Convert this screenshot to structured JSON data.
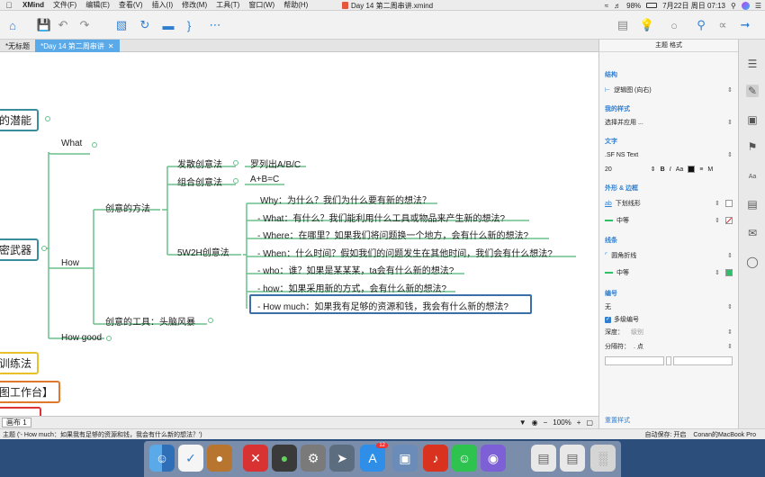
{
  "menubar": {
    "app": "XMind",
    "items": [
      "文件(F)",
      "编辑(E)",
      "查看(V)",
      "插入(I)",
      "修改(M)",
      "工具(T)",
      "窗口(W)",
      "帮助(H)"
    ],
    "doc_title": "Day 14 第二周串讲.xmind",
    "battery": "98%",
    "datetime": "7月22日 周日  07:13"
  },
  "tabs": [
    {
      "label": "*无标题"
    },
    {
      "label": "*Day 14 第二周串讲"
    }
  ],
  "map": {
    "root_fragment_1": "的潜能",
    "root_fragment_2": "密武器",
    "root_fragment_3": "训练法",
    "root_fragment_4": "图工作台】",
    "what": "What",
    "how": "How",
    "how_good": "How good",
    "method": "创意的方法",
    "tool": "创意的工具：头脑风暴",
    "divergent": "发散创意法",
    "divergent_detail": "罗列出A/B/C",
    "combine": "组合创意法",
    "combine_detail": "A+B=C",
    "w5h2": "5W2H创意法",
    "w5h2_items": [
      "Why：为什么？我们为什么要有新的想法？",
      "- What：有什么？我们能利用什么工具或物品来产生新的想法?",
      "- Where：在哪里？如果我们将问题换一个地方，会有什么新的想法?",
      "- When：什么时间？假如我们的问题发生在其他时间，我们会有什么想法?",
      "- who：谁？如果是某某某，ta会有什么新的想法?",
      "- how：如果采用新的方式，会有什么新的想法?",
      "- How much：如果我有足够的资源和钱，我会有什么新的想法?"
    ]
  },
  "canvas_status": {
    "sheet": "画布 1",
    "zoom": "100%"
  },
  "panel": {
    "title": "主题 格式",
    "structure_label": "结构",
    "structure_value": "逻辑图 (向右)",
    "my_style_label": "我的样式",
    "my_style_value": "选择并应用 ...",
    "text_label": "文字",
    "font_value": ".SF NS Text",
    "font_size": "20",
    "border_label": "外形 & 边框",
    "shape_value": "下划线形",
    "border_weight": "中等",
    "line_label": "线条",
    "line_shape": "圆角折线",
    "line_weight": "中等",
    "numbering_label": "编号",
    "numbering_value": "无",
    "multilevel": "多级编号",
    "depth_label": "深度：",
    "depth_value": "级别",
    "separator_label": "分隔符：",
    "separator_value": ". 点",
    "reset": "重置样式"
  },
  "statusbar": {
    "topic": "主题 ('- How much：如果我有足够的资源和钱，我会有什么新的想法？')",
    "autosave": "自动保存: 开启",
    "user": "Conan的MacBook Pro"
  },
  "dock": {
    "badge": "12"
  },
  "colors": {
    "branch_line": "#6cc18c",
    "accent": "#2f7fd1",
    "selection": "#3b6fa8"
  }
}
